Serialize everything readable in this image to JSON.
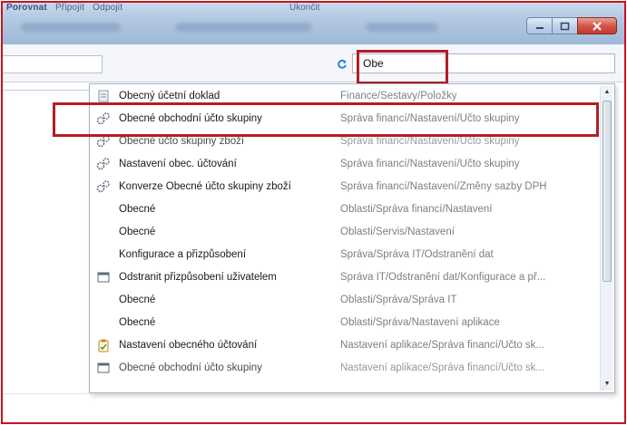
{
  "titlebar": {
    "menu_items": [
      "Porovnat",
      "Připojit",
      "Odpojit"
    ],
    "right_text": "Ukončit"
  },
  "search": {
    "value": "Obe",
    "refresh_icon": "refresh-icon"
  },
  "results": [
    {
      "icon": "report-icon",
      "name": "Obecný účetní doklad",
      "path": "Finance/Sestavy/Položky"
    },
    {
      "icon": "gears-icon",
      "name": "Obecné obchodní účto skupiny",
      "path": "Správa financí/Nastavení/Účto skupiny"
    },
    {
      "icon": "gears-icon",
      "name": "Obecné účto skupiny zboží",
      "path": "Správa financí/Nastavení/Účto skupiny"
    },
    {
      "icon": "gears-icon",
      "name": "Nastavení obec. účtování",
      "path": "Správa financí/Nastavení/Účto skupiny"
    },
    {
      "icon": "gears-icon",
      "name": "Konverze Obecné účto skupiny zboží",
      "path": "Správa financí/Nastavení/Změny sazby DPH"
    },
    {
      "icon": "",
      "name": "Obecné",
      "path": "Oblasti/Správa financí/Nastavení"
    },
    {
      "icon": "",
      "name": "Obecné",
      "path": "Oblasti/Servis/Nastavení"
    },
    {
      "icon": "",
      "name": "Konfigurace a přizpůsobení",
      "path": "Správa/Správa IT/Odstranění dat"
    },
    {
      "icon": "window-icon",
      "name": "Odstranit přizpůsobení uživatelem",
      "path": "Správa IT/Odstranění dat/Konfigurace a př..."
    },
    {
      "icon": "",
      "name": "Obecné",
      "path": "Oblasti/Správa/Správa IT"
    },
    {
      "icon": "",
      "name": "Obecné",
      "path": "Oblasti/Správa/Nastavení aplikace"
    },
    {
      "icon": "clipboard-icon",
      "name": "Nastavení obecného účtování",
      "path": "Nastavení aplikace/Správa financí/Účto sk..."
    },
    {
      "icon": "window-icon",
      "name": "Obecné obchodní účto skupiny",
      "path": "Nastavení aplikace/Správa financí/Účto sk..."
    }
  ],
  "colors": {
    "highlight": "#b21e26",
    "titlebar": "#b2c8e2",
    "path_text": "#7a8088"
  }
}
